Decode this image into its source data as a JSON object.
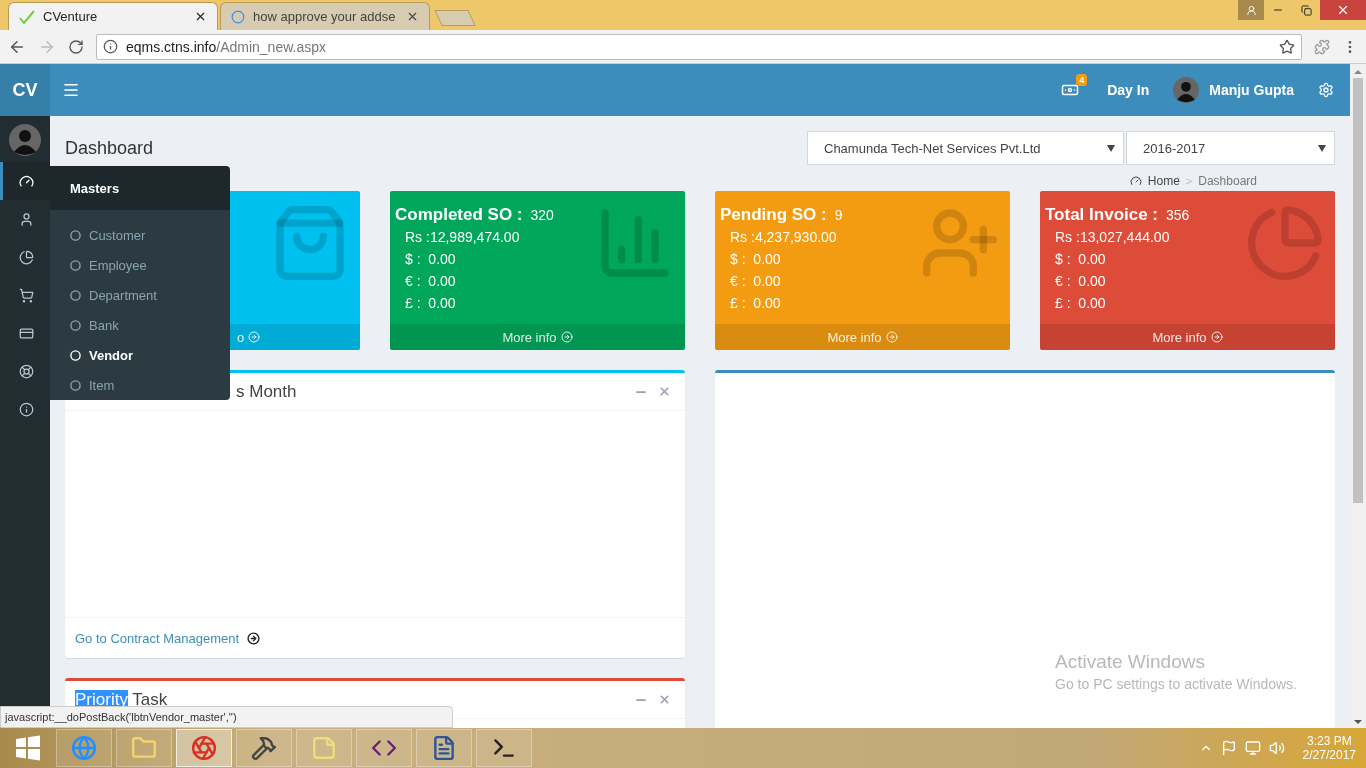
{
  "browser": {
    "tabs": [
      {
        "title": "CVenture",
        "selected": true
      },
      {
        "title": "how approve your addse",
        "selected": false
      }
    ],
    "url": {
      "host": "eqms.ctns.info",
      "path": "/Admin_new.aspx"
    }
  },
  "topbar": {
    "logo": "CV",
    "notification_count": "4",
    "day_in": "Day In",
    "user_name": "Manju Gupta"
  },
  "rail": [
    {
      "kind": "dashboard",
      "selected": true
    },
    {
      "kind": "user",
      "selected": false
    },
    {
      "kind": "pie",
      "selected": false
    },
    {
      "kind": "cart",
      "selected": false
    },
    {
      "kind": "card",
      "selected": false
    },
    {
      "kind": "lifebuoy",
      "selected": false
    },
    {
      "kind": "info",
      "selected": false
    }
  ],
  "flyout": {
    "title": "Masters",
    "items": [
      {
        "label": "Customer",
        "selected": false
      },
      {
        "label": "Employee",
        "selected": false
      },
      {
        "label": "Department",
        "selected": false
      },
      {
        "label": "Bank",
        "selected": false
      },
      {
        "label": "Vendor",
        "selected": true
      },
      {
        "label": "Item",
        "selected": false
      }
    ]
  },
  "page": {
    "title": "Dashboard",
    "company_select": "Chamunda Tech-Net Services Pvt.Ltd",
    "year_select": "2016-2017",
    "breadcrumb": [
      "Home",
      ">",
      "Dashboard"
    ]
  },
  "cards": [
    {
      "kind": "bag",
      "color": "#00c0ef",
      "footer": "o"
    },
    {
      "kind": "bars",
      "color": "#00a65a",
      "title": "Completed SO :",
      "count": "320",
      "lines": [
        "Rs :12,989,474.00",
        "$ :  0.00",
        "€ :  0.00",
        "£ :  0.00"
      ],
      "footer": "More info"
    },
    {
      "kind": "user-plus",
      "color": "#f39c12",
      "title": "Pending SO :",
      "count": "9",
      "lines": [
        "Rs :4,237,930.00",
        "$ :  0.00",
        "€ :  0.00",
        "£ :  0.00"
      ],
      "footer": "More info"
    },
    {
      "kind": "pie",
      "color": "#dd4b39",
      "title": "Total Invoice :",
      "count": "356",
      "lines": [
        "Rs :13,027,444.00",
        "$ :  0.00",
        "€ :  0.00",
        "£ :  0.00"
      ],
      "footer": "More info"
    }
  ],
  "panels": [
    {
      "color": "#00c0ef",
      "title_parts": [
        {
          "text": "s Month",
          "selected": false
        }
      ],
      "link": "Go to Contract Management"
    },
    {
      "color": "#dd4b39",
      "title_parts": [
        {
          "text": "Priority",
          "selected": true
        },
        {
          "text": " Task",
          "selected": false
        }
      ]
    }
  ],
  "side_panel": {
    "color": "#3c8dbc"
  },
  "status_url": "javascript:__doPostBack('lbtnVendor_master','')",
  "os_notice": {
    "title": "Activate Windows",
    "subtitle": "Go to PC settings to activate Windows."
  },
  "taskbar": {
    "apps": [
      {
        "kind": "ie",
        "selected": false
      },
      {
        "kind": "explorer",
        "selected": false
      },
      {
        "kind": "chrome",
        "selected": true
      },
      {
        "kind": "tools",
        "selected": false
      },
      {
        "kind": "notes",
        "selected": false
      },
      {
        "kind": "vs",
        "selected": false
      },
      {
        "kind": "word",
        "selected": false
      },
      {
        "kind": "cmd",
        "selected": false
      }
    ],
    "time": "3:23 PM",
    "date": "2/27/2017"
  }
}
